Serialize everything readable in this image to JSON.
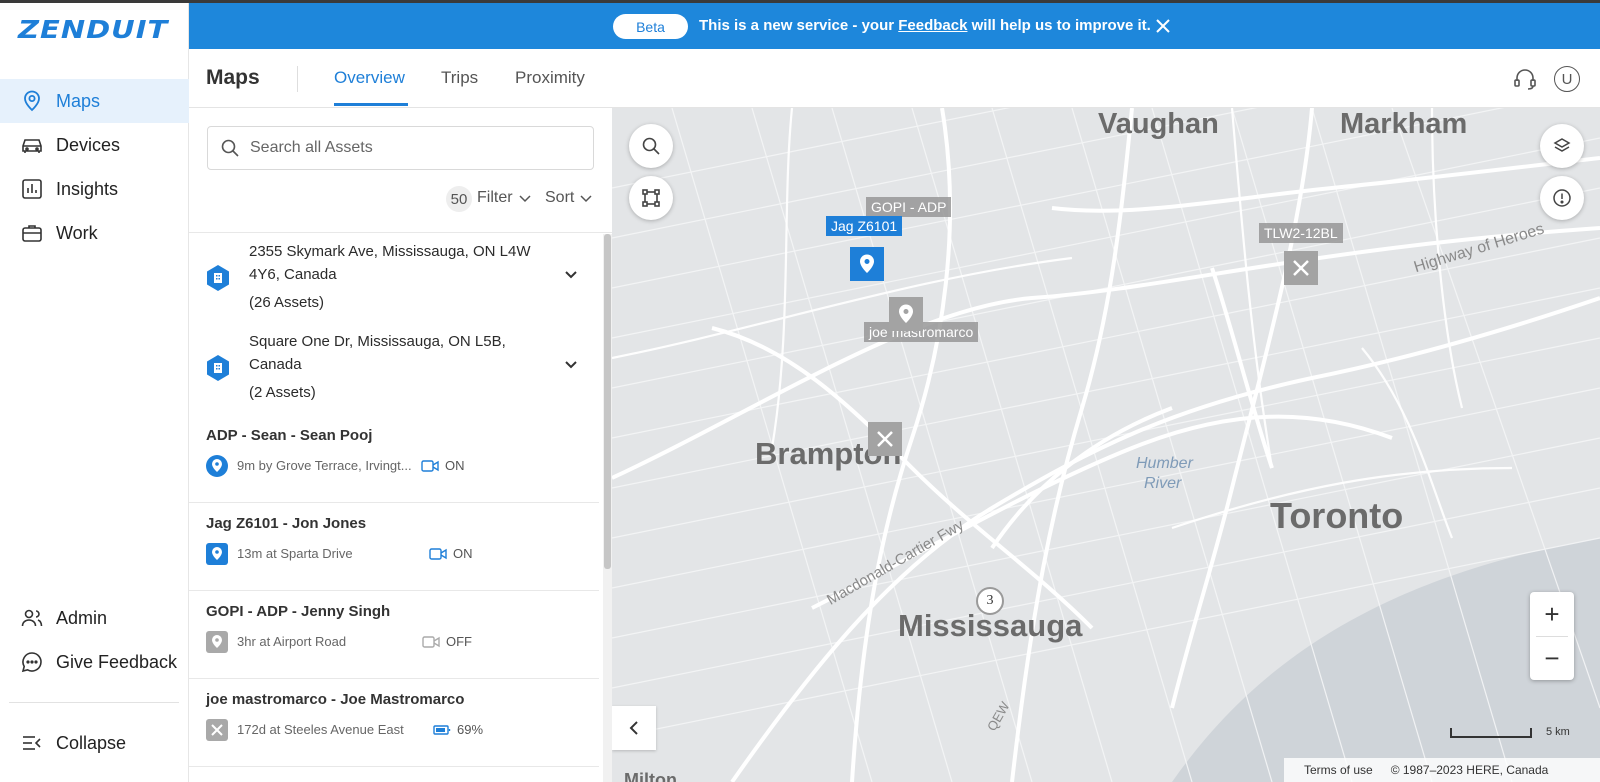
{
  "app": {
    "logo": "ZENDUIT",
    "accent": "#1e7fd8"
  },
  "nav": {
    "items": [
      {
        "label": "Maps",
        "icon": "map-pin-icon",
        "active": true
      },
      {
        "label": "Devices",
        "icon": "car-icon"
      },
      {
        "label": "Insights",
        "icon": "chart-icon"
      },
      {
        "label": "Work",
        "icon": "briefcase-icon"
      }
    ],
    "bottom": [
      {
        "label": "Admin",
        "icon": "users-icon"
      },
      {
        "label": "Give Feedback",
        "icon": "chat-icon"
      }
    ],
    "collapse": "Collapse"
  },
  "banner": {
    "badge": "Beta",
    "text_before": "This is a new service - your ",
    "link": "Feedback",
    "text_after": " will help us to improve it."
  },
  "header": {
    "title": "Maps",
    "tabs": [
      "Overview",
      "Trips",
      "Proximity"
    ],
    "active_tab": "Overview",
    "avatar": "U"
  },
  "panel": {
    "search_placeholder": "Search all Assets",
    "count": "50",
    "filter": "Filter",
    "sort": "Sort",
    "locations": [
      {
        "address": "2355 Skymark Ave, Mississauga, ON L4W 4Y6, Canada",
        "count": "(26 Assets)"
      },
      {
        "address": "Square One Dr, Mississauga, ON L5B, Canada",
        "count": "(2 Assets)"
      }
    ],
    "assets": [
      {
        "name": "ADP - Sean - Sean Pooj",
        "detail": "9m by Grove Terrace, Irvingt...",
        "status": "ON",
        "status_icon": "camera-icon",
        "icon": "pin-icon"
      },
      {
        "name": "Jag Z6101 - Jon Jones",
        "detail": "13m at Sparta Drive",
        "status": "ON",
        "status_icon": "camera-icon",
        "icon": "pin-icon"
      },
      {
        "name": "GOPI - ADP - Jenny Singh",
        "detail": "3hr at Airport Road",
        "status": "OFF",
        "status_icon": "camera-icon",
        "icon": "pin-icon"
      },
      {
        "name": "joe mastromarco - Joe Mastromarco",
        "detail": "172d at Steeles Avenue East",
        "status": "69%",
        "status_icon": "battery-icon",
        "icon": "tools-icon"
      }
    ]
  },
  "map": {
    "cities": [
      "Vaughan",
      "Markham",
      "Brampton",
      "Toronto",
      "Mississauga",
      "Milton"
    ],
    "water": [
      "Humber",
      "River"
    ],
    "roads": [
      "Highway of Heroes",
      "Macdonald-Cartier Fwy",
      "QEW"
    ],
    "markers": [
      "Jag Z6101",
      "GOPI - ADP",
      "TLW2-12BL",
      "joe mastromarco"
    ],
    "cluster": "3",
    "zoom_in": "+",
    "zoom_out": "−",
    "scale": "5 km",
    "terms": "Terms of use",
    "copyright": "© 1987–2023 HERE, Canada"
  }
}
